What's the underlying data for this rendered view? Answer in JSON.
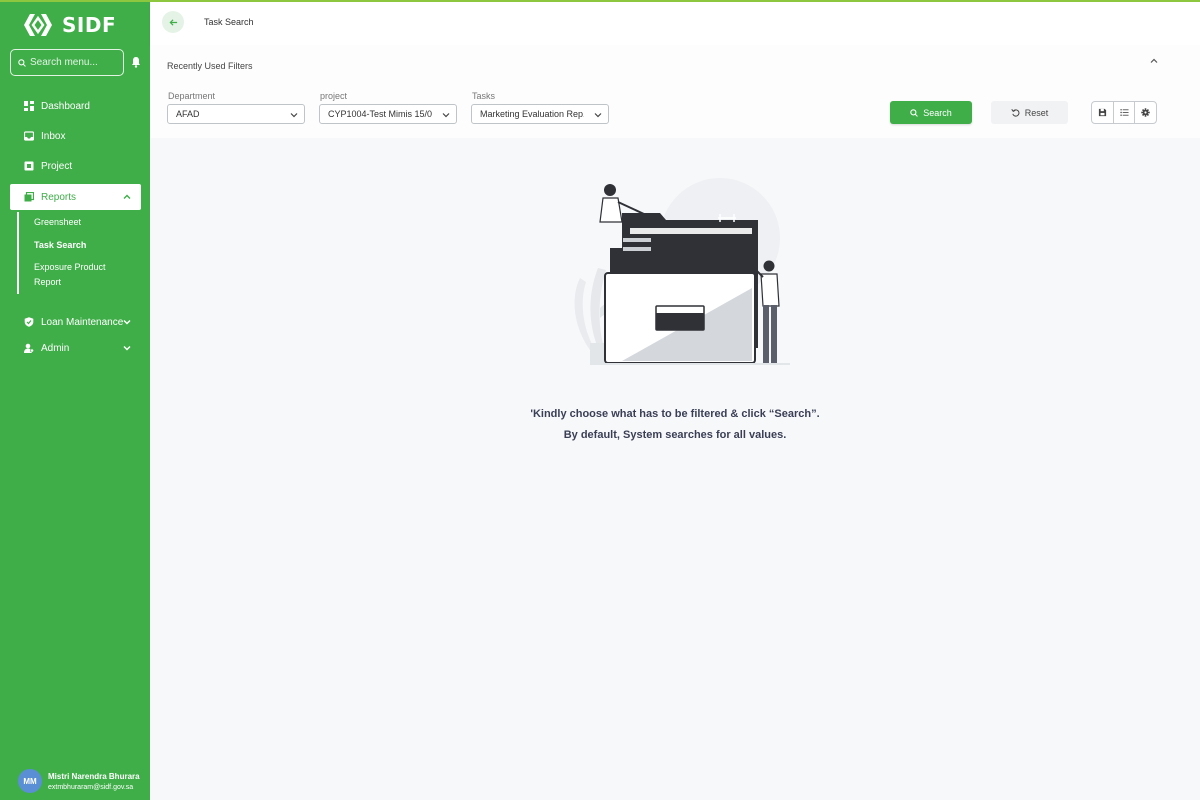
{
  "app": {
    "brand": "SIDF",
    "accent": "#3fae49"
  },
  "sidebar": {
    "search_placeholder": "Search menu...",
    "items": [
      {
        "label": "Dashboard",
        "icon": "dashboard-icon"
      },
      {
        "label": "Inbox",
        "icon": "inbox-icon"
      },
      {
        "label": "Project",
        "icon": "project-icon"
      },
      {
        "label": "Reports",
        "icon": "reports-icon",
        "expanded": true
      },
      {
        "label": "Loan Maintenance",
        "icon": "shield-icon"
      },
      {
        "label": "Admin",
        "icon": "admin-icon"
      }
    ],
    "reports_sub": [
      {
        "label": "Greensheet"
      },
      {
        "label": "Task Search",
        "selected": true
      },
      {
        "label": "Exposure Product Report"
      }
    ]
  },
  "user": {
    "initials": "MM",
    "name": "Mistri Narendra Bhurara",
    "email": "extmbhuraram@sidf.gov.sa"
  },
  "header": {
    "title": "Task Search"
  },
  "filters": {
    "title": "Recently Used Filters",
    "department": {
      "label": "Department",
      "value": "AFAD"
    },
    "project": {
      "label": "project",
      "value": "CYP1004-Test Mimis 15/0..."
    },
    "tasks": {
      "label": "Tasks",
      "value": "Marketing Evaluation Rep..."
    },
    "search_label": "Search",
    "reset_label": "Reset"
  },
  "empty_state": {
    "line1": "'Kindly choose what has to be filtered & click “Search”.",
    "line2": "By default, System searches for all values."
  }
}
